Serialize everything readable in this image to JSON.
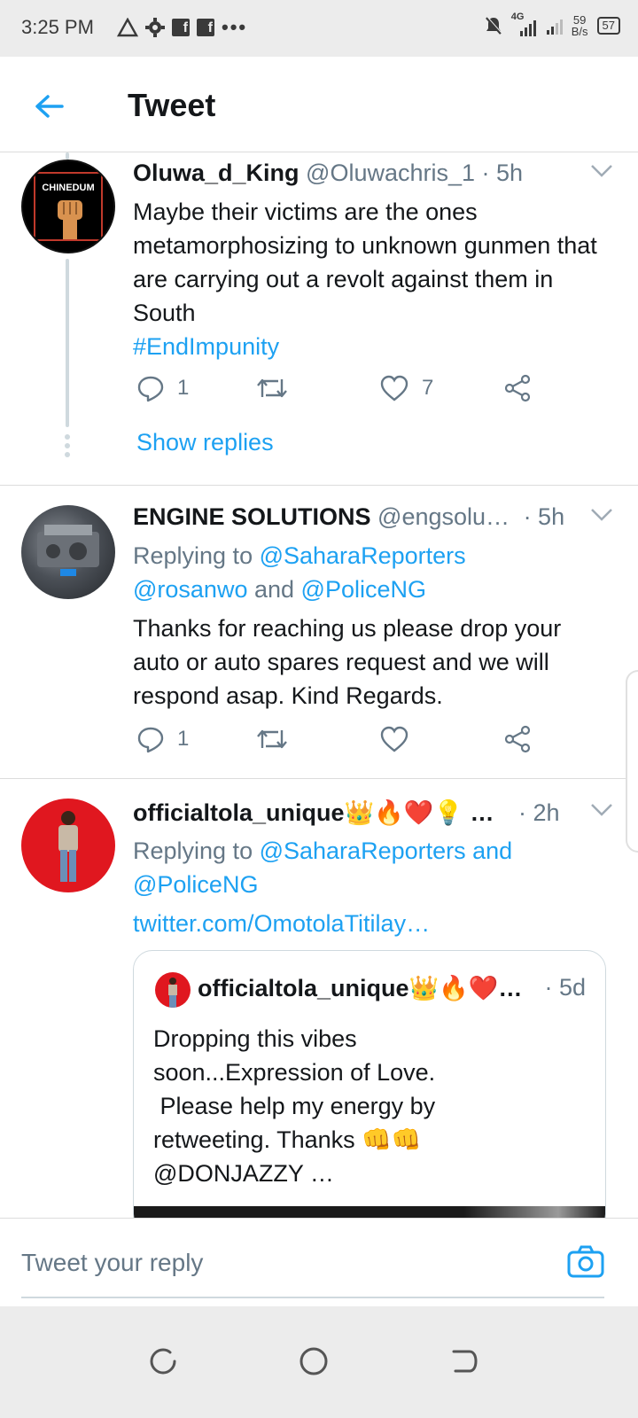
{
  "status_bar": {
    "time": "3:25 PM",
    "net_type": "4G",
    "net_speed_value": "59",
    "net_speed_unit": "B/s",
    "battery": "57"
  },
  "header": {
    "title": "Tweet"
  },
  "tweets": [
    {
      "name": "Oluwa_d_King",
      "handle": "@Oluwachris_1",
      "time": "· 5h",
      "avatar_text": "CHINEDUM",
      "text": "Maybe their victims are the ones metamorphosizing to unknown gunmen that are carrying out a revolt against them in South",
      "hashtag": "#EndImpunity",
      "replies": "1",
      "likes": "7",
      "show_replies": "Show replies"
    },
    {
      "name": "ENGINE SOLUTIONS",
      "handle": "@engsolu…",
      "time": "· 5h",
      "replying_prefix": "Replying to ",
      "replying_to_1": "@SaharaReporters",
      "replying_to_2": "@rosanwo",
      "replying_and": " and ",
      "replying_to_3": "@PoliceNG",
      "text": "Thanks for reaching us please drop your auto or auto spares request and we will respond asap. Kind Regards.",
      "replies": "1"
    },
    {
      "name": "officialtola_unique👑🔥❤️💡 …",
      "time": "· 2h",
      "replying_prefix": "Replying to ",
      "replying_to_1": "@SaharaReporters",
      "replying_and": " and",
      "replying_to_2": "@PoliceNG",
      "link": "twitter.com/OmotolaTitilay…",
      "quote": {
        "name": "officialtola_unique👑🔥❤️…",
        "time": "· 5d",
        "text_line1": "Dropping this vibes",
        "text_line2": "soon...Expression of Love.",
        "text_line3": " Please help my energy by",
        "text_line4": "retweeting. Thanks 👊👊",
        "text_line5": "@DONJAZZY …"
      }
    }
  ],
  "reply_bar": {
    "placeholder": "Tweet your reply"
  },
  "colors": {
    "accent": "#1da1f2",
    "secondary_text": "#657786",
    "divider": "#dcdcdc"
  }
}
